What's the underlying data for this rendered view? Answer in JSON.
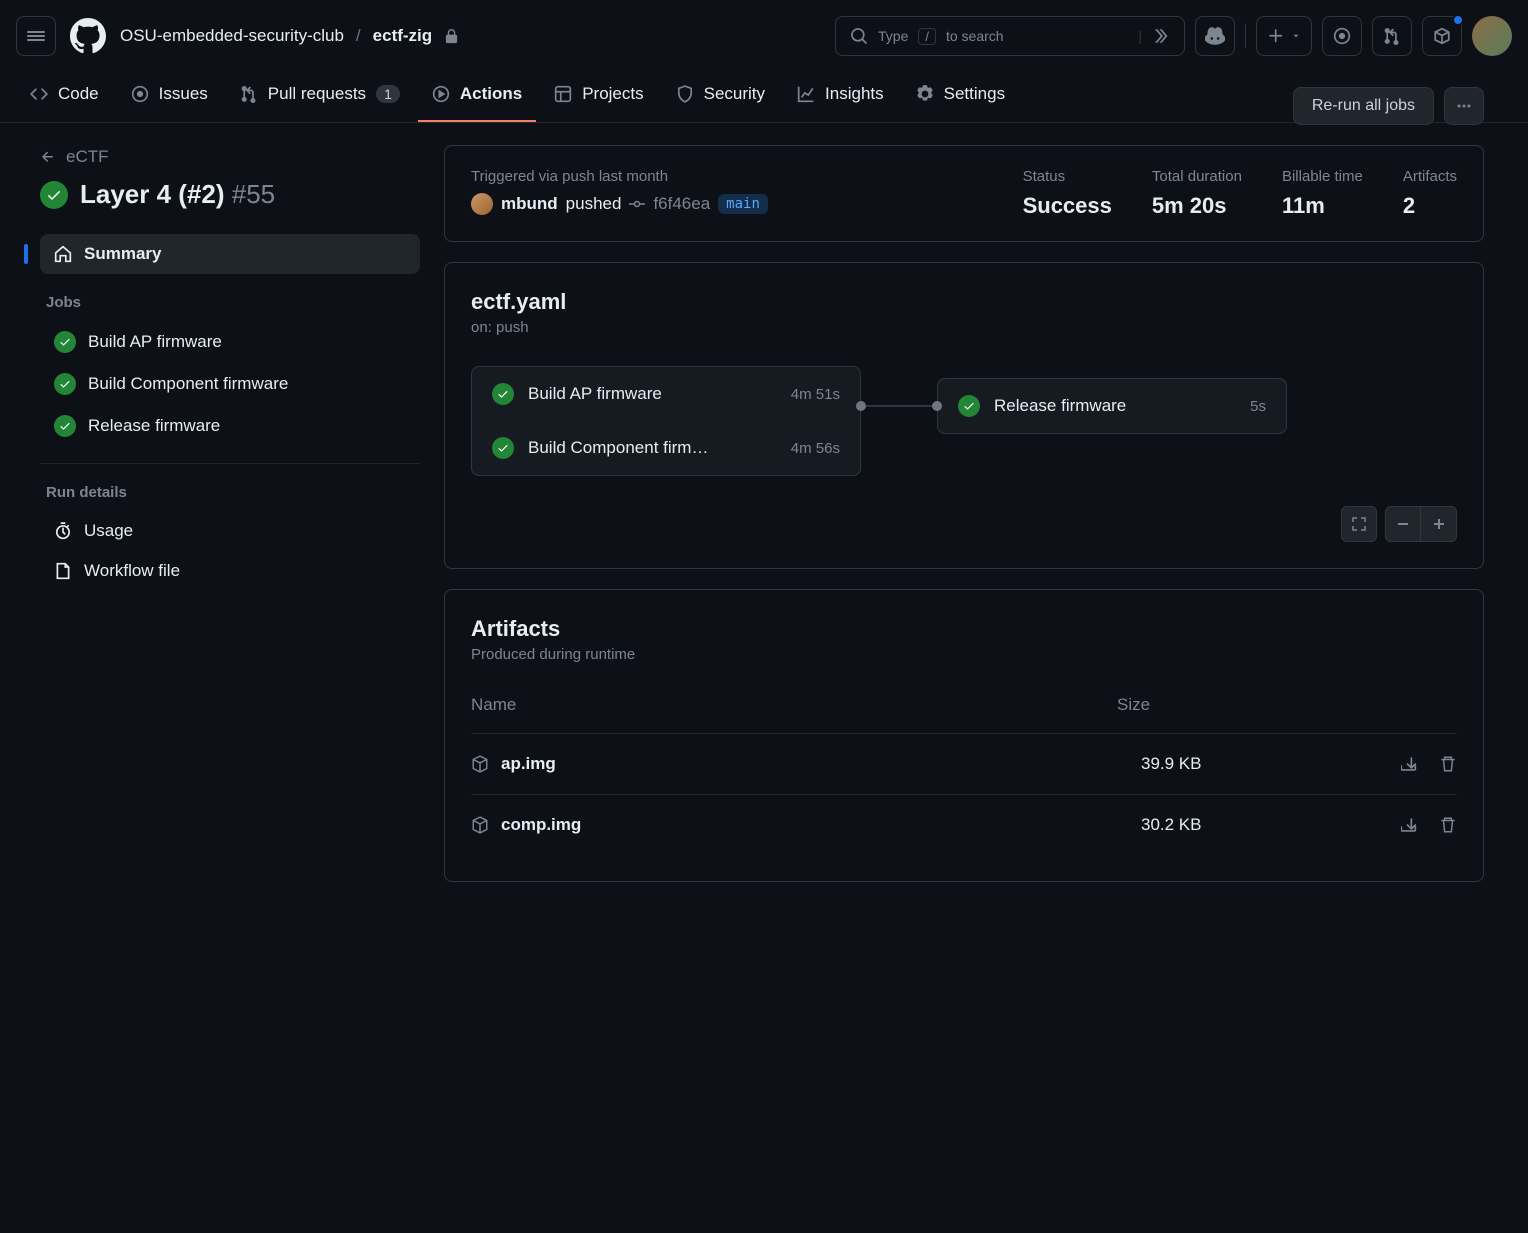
{
  "breadcrumb": {
    "org": "OSU-embedded-security-club",
    "sep": "/",
    "repo": "ectf-zig"
  },
  "search": {
    "prefix": "Type",
    "key": "/",
    "suffix": "to search"
  },
  "nav": {
    "code": "Code",
    "issues": "Issues",
    "pulls": "Pull requests",
    "pulls_count": "1",
    "actions": "Actions",
    "projects": "Projects",
    "security": "Security",
    "insights": "Insights",
    "settings": "Settings"
  },
  "back": {
    "label": "eCTF"
  },
  "run": {
    "title": "Layer 4 (#2)",
    "number": "#55"
  },
  "actions_buttons": {
    "rerun": "Re-run all jobs"
  },
  "sidebar": {
    "summary": "Summary",
    "jobs_label": "Jobs",
    "jobs": [
      {
        "label": "Build AP firmware"
      },
      {
        "label": "Build Component firmware"
      },
      {
        "label": "Release firmware"
      }
    ],
    "details_label": "Run details",
    "usage": "Usage",
    "workflow_file": "Workflow file"
  },
  "summary": {
    "trigger_label": "Triggered via push last month",
    "user": "mbund",
    "action": "pushed",
    "sha": "f6f46ea",
    "branch": "main",
    "status_label": "Status",
    "status": "Success",
    "duration_label": "Total duration",
    "duration": "5m 20s",
    "billable_label": "Billable time",
    "billable": "11m",
    "artifacts_label": "Artifacts",
    "artifacts_count": "2"
  },
  "workflow": {
    "file": "ectf.yaml",
    "on": "on: push",
    "stage1": [
      {
        "name": "Build AP firmware",
        "time": "4m 51s"
      },
      {
        "name": "Build Component firm…",
        "time": "4m 56s"
      }
    ],
    "stage2": {
      "name": "Release firmware",
      "time": "5s"
    }
  },
  "artifacts": {
    "title": "Artifacts",
    "subtitle": "Produced during runtime",
    "col_name": "Name",
    "col_size": "Size",
    "rows": [
      {
        "name": "ap.img",
        "size": "39.9 KB"
      },
      {
        "name": "comp.img",
        "size": "30.2 KB"
      }
    ]
  }
}
